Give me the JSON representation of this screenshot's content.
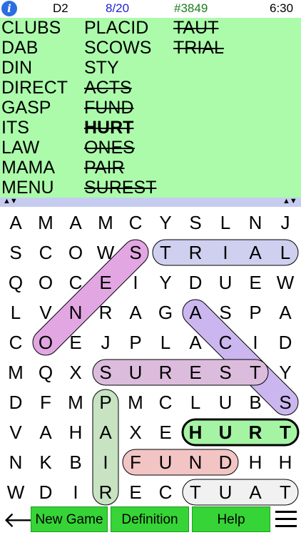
{
  "status": {
    "info_icon": "i",
    "level": "D2",
    "progress": "8/20",
    "puzzle_number": "#3849",
    "time": "6:30"
  },
  "word_list": {
    "columns": [
      [
        "CLUBS",
        "DAB",
        "DIN",
        "DIRECT",
        "GASP",
        "ITS",
        "LAW",
        "MAMA",
        "MENU"
      ],
      [
        "PLACID",
        "SCOWS",
        "STY",
        "ACTS",
        "FUND",
        "HURT",
        "ONES",
        "PAIR",
        "SUREST"
      ],
      [
        "TAUT",
        "TRIAL"
      ]
    ],
    "found": [
      "ACTS",
      "FUND",
      "HURT",
      "ONES",
      "PAIR",
      "SUREST",
      "TAUT",
      "TRIAL"
    ],
    "current": "HURT"
  },
  "grid": {
    "rows": [
      [
        "A",
        "M",
        "A",
        "M",
        "C",
        "Y",
        "S",
        "L",
        "N",
        "J"
      ],
      [
        "S",
        "C",
        "O",
        "W",
        "S",
        "T",
        "R",
        "I",
        "A",
        "L"
      ],
      [
        "Q",
        "O",
        "C",
        "E",
        "I",
        "Y",
        "D",
        "U",
        "E",
        "W"
      ],
      [
        "L",
        "V",
        "N",
        "R",
        "A",
        "G",
        "A",
        "S",
        "P",
        "A"
      ],
      [
        "C",
        "O",
        "E",
        "J",
        "P",
        "L",
        "A",
        "C",
        "I",
        "D"
      ],
      [
        "M",
        "Q",
        "X",
        "S",
        "U",
        "R",
        "E",
        "S",
        "T",
        "Y"
      ],
      [
        "D",
        "F",
        "M",
        "P",
        "M",
        "C",
        "L",
        "U",
        "B",
        "S"
      ],
      [
        "V",
        "A",
        "H",
        "A",
        "X",
        "E",
        "H",
        "U",
        "R",
        "T"
      ],
      [
        "N",
        "K",
        "B",
        "I",
        "F",
        "U",
        "N",
        "D",
        "H",
        "H"
      ],
      [
        "W",
        "D",
        "I",
        "R",
        "E",
        "C",
        "T",
        "U",
        "A",
        "T"
      ]
    ],
    "found_words": [
      {
        "word": "TRIAL",
        "start": [
          1,
          5
        ],
        "end": [
          1,
          9
        ],
        "color": "#cfcff0"
      },
      {
        "word": "ONES",
        "start": [
          4,
          1
        ],
        "end": [
          1,
          4
        ],
        "color": "#e2a6e2"
      },
      {
        "word": "ACTS",
        "start": [
          3,
          6
        ],
        "end": [
          6,
          9
        ],
        "color": "#cbb6f0"
      },
      {
        "word": "SUREST",
        "start": [
          5,
          3
        ],
        "end": [
          5,
          8
        ],
        "color": "#dcbcdc"
      },
      {
        "word": "PAIR",
        "start": [
          6,
          3
        ],
        "end": [
          9,
          3
        ],
        "color": "#c7e3c2"
      },
      {
        "word": "FUND",
        "start": [
          8,
          4
        ],
        "end": [
          8,
          7
        ],
        "color": "#f2c4c4"
      },
      {
        "word": "TAUT",
        "start": [
          9,
          6
        ],
        "end": [
          9,
          9
        ],
        "color": "#f1f1f1"
      },
      {
        "word": "HURT",
        "start": [
          7,
          6
        ],
        "end": [
          7,
          9
        ],
        "color": "#a4f4a4"
      }
    ]
  },
  "bottom_bar": {
    "back_arrow": "🡐",
    "new_game": "New Game",
    "definition": "Definition",
    "help": "Help"
  }
}
